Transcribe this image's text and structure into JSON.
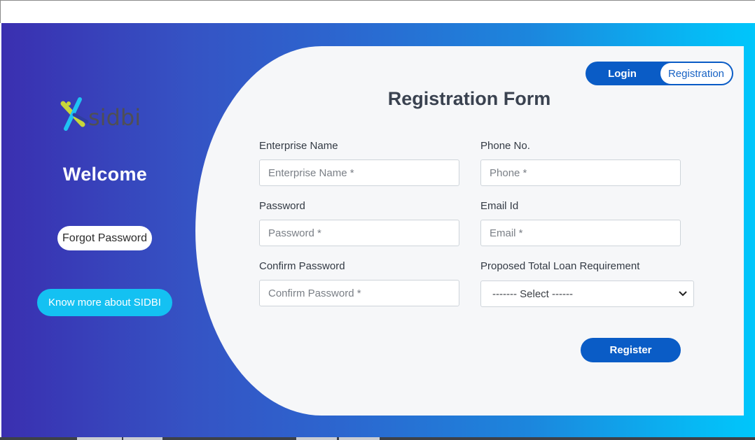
{
  "brand": {
    "logo_text": "sidbi"
  },
  "left": {
    "welcome": "Welcome",
    "forgot_label": "Forgot Password",
    "know_more_label": "Know more about SIDBI"
  },
  "toggle": {
    "login_label": "Login",
    "registration_label": "Registration"
  },
  "form": {
    "title": "Registration Form",
    "enterprise": {
      "label": "Enterprise Name",
      "placeholder": "Enterprise Name *"
    },
    "phone": {
      "label": "Phone No.",
      "placeholder": "Phone *"
    },
    "password": {
      "label": "Password",
      "placeholder": "Password *"
    },
    "email": {
      "label": "Email Id",
      "placeholder": "Email *"
    },
    "confirm": {
      "label": "Confirm Password",
      "placeholder": "Confirm Password *"
    },
    "loan": {
      "label": "Proposed Total Loan Requirement",
      "selected": "------- Select ------"
    },
    "register_label": "Register"
  },
  "colors": {
    "primary": "#0a5cc6",
    "accent": "#14c1f2",
    "gradient_start": "#3a2fb0",
    "gradient_end": "#00c6fb"
  },
  "icons": {
    "select": "chevron-down-icon",
    "logo": "sidbi-logo-icon"
  }
}
